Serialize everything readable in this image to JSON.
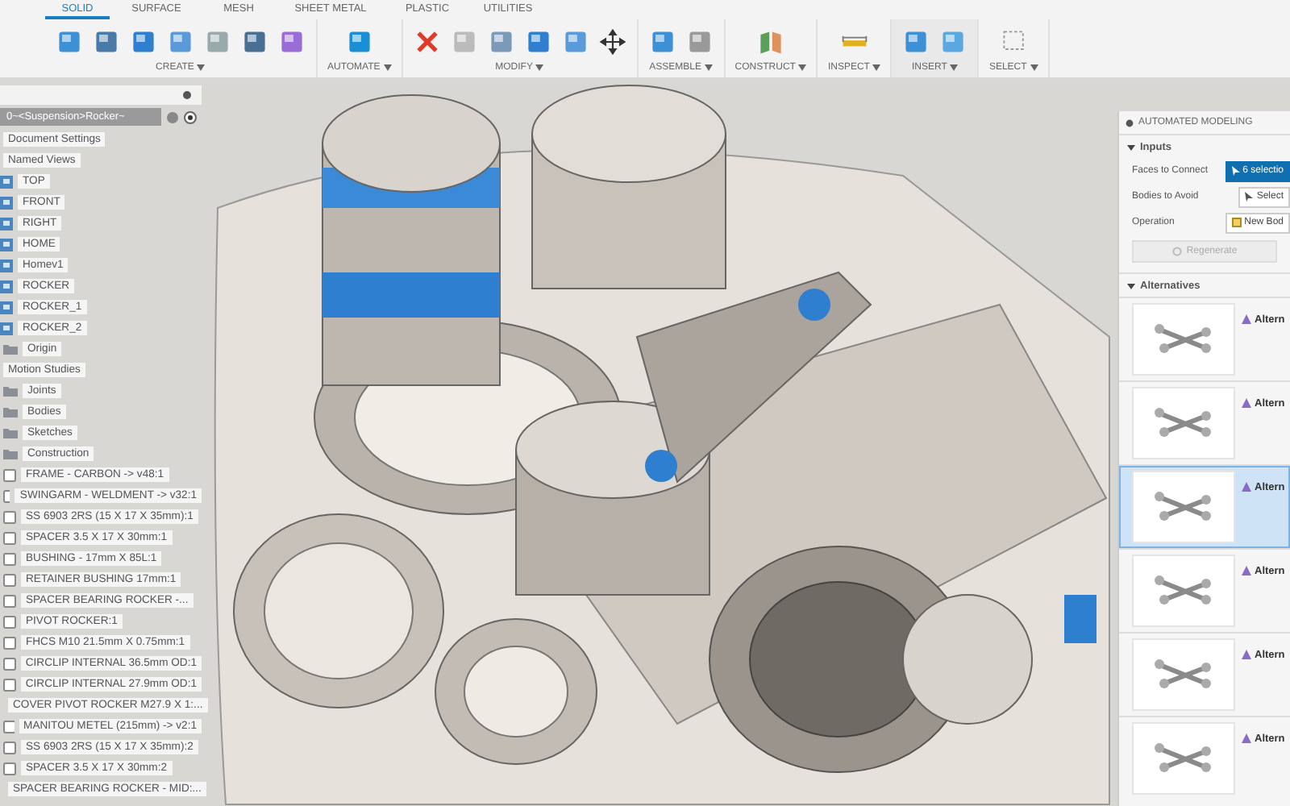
{
  "toolbar": {
    "tabs": [
      {
        "label": "SOLID",
        "selected": true
      },
      {
        "label": "SURFACE",
        "selected": false
      },
      {
        "label": "MESH",
        "selected": false
      },
      {
        "label": "SHEET METAL",
        "selected": false
      },
      {
        "label": "PLASTIC",
        "selected": false
      },
      {
        "label": "UTILITIES",
        "selected": false
      }
    ],
    "groups": [
      {
        "label": "CREATE"
      },
      {
        "label": "AUTOMATE"
      },
      {
        "label": "MODIFY"
      },
      {
        "label": "ASSEMBLE"
      },
      {
        "label": "CONSTRUCT"
      },
      {
        "label": "INSPECT"
      },
      {
        "label": "INSERT"
      },
      {
        "label": "SELECT"
      }
    ]
  },
  "browser": {
    "document": "0~<Suspension>Rocker~",
    "items": [
      {
        "kind": "setting",
        "label": "Document Settings"
      },
      {
        "kind": "section",
        "label": "Named Views"
      },
      {
        "kind": "view",
        "label": "TOP"
      },
      {
        "kind": "view",
        "label": "FRONT"
      },
      {
        "kind": "view",
        "label": "RIGHT"
      },
      {
        "kind": "view",
        "label": "HOME"
      },
      {
        "kind": "view",
        "label": "Homev1"
      },
      {
        "kind": "view",
        "label": "ROCKER"
      },
      {
        "kind": "view",
        "label": "ROCKER_1"
      },
      {
        "kind": "view",
        "label": "ROCKER_2"
      },
      {
        "kind": "folder",
        "label": "Origin"
      },
      {
        "kind": "section",
        "label": "Motion Studies"
      },
      {
        "kind": "folder",
        "label": "Joints"
      },
      {
        "kind": "folder",
        "label": "Bodies"
      },
      {
        "kind": "folder",
        "label": "Sketches"
      },
      {
        "kind": "folder",
        "label": "Construction"
      },
      {
        "kind": "component",
        "label": "FRAME - CARBON -> v48:1"
      },
      {
        "kind": "component",
        "label": "SWINGARM - WELDMENT -> v32:1"
      },
      {
        "kind": "component",
        "label": "SS 6903 2RS (15 X 17 X 35mm):1"
      },
      {
        "kind": "component",
        "label": "SPACER 3.5 X 17 X 30mm:1"
      },
      {
        "kind": "component",
        "label": "BUSHING - 17mm X 85L:1"
      },
      {
        "kind": "component",
        "label": "RETAINER BUSHING 17mm:1"
      },
      {
        "kind": "component",
        "label": "SPACER BEARING ROCKER -..."
      },
      {
        "kind": "component",
        "label": "PIVOT ROCKER:1"
      },
      {
        "kind": "component",
        "label": "FHCS M10 21.5mm X 0.75mm:1"
      },
      {
        "kind": "component",
        "label": "CIRCLIP INTERNAL 36.5mm OD:1"
      },
      {
        "kind": "component",
        "label": "CIRCLIP INTERNAL 27.9mm OD:1"
      },
      {
        "kind": "component",
        "label": "COVER PIVOT ROCKER M27.9 X 1:..."
      },
      {
        "kind": "component",
        "label": "MANITOU METEL (215mm) -> v2:1"
      },
      {
        "kind": "component",
        "label": "SS 6903 2RS (15 X 17 X 35mm):2"
      },
      {
        "kind": "component",
        "label": "SPACER 3.5 X 17 X 30mm:2"
      },
      {
        "kind": "component",
        "label": "SPACER BEARING ROCKER - MID:..."
      }
    ]
  },
  "panel": {
    "title": "AUTOMATED MODELING",
    "inputs": {
      "label": "Inputs",
      "rows": [
        {
          "label": "Faces to Connect",
          "value": "6 selectio",
          "kind": "selected"
        },
        {
          "label": "Bodies to Avoid",
          "value": "Select",
          "kind": "select"
        },
        {
          "label": "Operation",
          "value": "New Bod",
          "kind": "operation"
        }
      ],
      "action": "Regenerate"
    },
    "alternatives": {
      "label": "Alternatives",
      "items": [
        {
          "label": "Altern",
          "selected": false
        },
        {
          "label": "Altern",
          "selected": false
        },
        {
          "label": "Altern",
          "selected": true
        },
        {
          "label": "Altern",
          "selected": false
        },
        {
          "label": "Altern",
          "selected": false
        },
        {
          "label": "Altern",
          "selected": false
        }
      ]
    }
  }
}
